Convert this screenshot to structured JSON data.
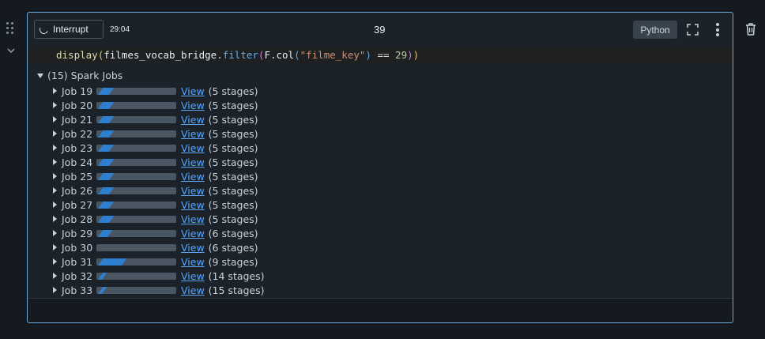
{
  "gutter": {
    "drag_icon": "drag-handle-icon",
    "collapse_icon": "chevron-down-icon",
    "delete_icon": "trash-icon"
  },
  "toolbar": {
    "interrupt_label": "Interrupt",
    "timer": "29:04",
    "execution_count": "39",
    "language_label": "Python",
    "expand_icon": "fullscreen-icon",
    "menu_icon": "kebab-menu-icon"
  },
  "code": {
    "fn": "display",
    "var": "filmes_vocab_bridge",
    "method": "filter",
    "arg_obj": "F.col",
    "arg_str": "\"filme_key\"",
    "op": " == ",
    "num": "29"
  },
  "spark": {
    "header": "(15) Spark Jobs",
    "jobs": [
      {
        "label": "Job 19",
        "view": "View",
        "stages": "(5 stages)",
        "progress": 0.14
      },
      {
        "label": "Job 20",
        "view": "View",
        "stages": "(5 stages)",
        "progress": 0.14
      },
      {
        "label": "Job 21",
        "view": "View",
        "stages": "(5 stages)",
        "progress": 0.14
      },
      {
        "label": "Job 22",
        "view": "View",
        "stages": "(5 stages)",
        "progress": 0.14
      },
      {
        "label": "Job 23",
        "view": "View",
        "stages": "(5 stages)",
        "progress": 0.14
      },
      {
        "label": "Job 24",
        "view": "View",
        "stages": "(5 stages)",
        "progress": 0.14
      },
      {
        "label": "Job 25",
        "view": "View",
        "stages": "(5 stages)",
        "progress": 0.14
      },
      {
        "label": "Job 26",
        "view": "View",
        "stages": "(5 stages)",
        "progress": 0.14
      },
      {
        "label": "Job 27",
        "view": "View",
        "stages": "(5 stages)",
        "progress": 0.14
      },
      {
        "label": "Job 28",
        "view": "View",
        "stages": "(5 stages)",
        "progress": 0.14
      },
      {
        "label": "Job 29",
        "view": "View",
        "stages": "(6 stages)",
        "progress": 0.12
      },
      {
        "label": "Job 30",
        "view": "View",
        "stages": "(6 stages)",
        "progress": 0.0
      },
      {
        "label": "Job 31",
        "view": "View",
        "stages": "(9 stages)",
        "progress": 0.3
      },
      {
        "label": "Job 32",
        "view": "View",
        "stages": "(14 stages)",
        "progress": 0.05
      },
      {
        "label": "Job 33",
        "view": "View",
        "stages": "(15 stages)",
        "progress": 0.05
      }
    ]
  },
  "colors": {
    "accent": "#58a6ff",
    "border": "#6fa9d6",
    "progress_fill": "#2f7fd1"
  }
}
